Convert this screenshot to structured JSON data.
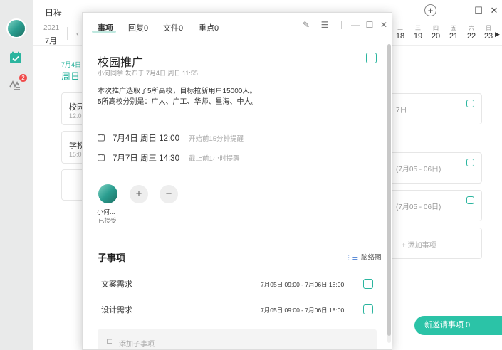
{
  "rail": {
    "badge": "2"
  },
  "app": {
    "title": "日程"
  },
  "datebar": {
    "year": "2021",
    "month": "7月",
    "days": [
      {
        "w": "二",
        "d": "18"
      },
      {
        "w": "三",
        "d": "19"
      },
      {
        "w": "四",
        "d": "20"
      },
      {
        "w": "五",
        "d": "21"
      },
      {
        "w": "六",
        "d": "22"
      },
      {
        "w": "日",
        "d": "23"
      }
    ]
  },
  "selected": {
    "small": "7月4日",
    "big": "周日"
  },
  "bg_cards": [
    {
      "t": "校园",
      "s": "12:0"
    },
    {
      "t": "学校",
      "s": "15:0"
    }
  ],
  "right_cards": [
    {
      "txt": "7日"
    },
    {
      "txt": "(7月05 - 06日)"
    },
    {
      "txt": "(7月05 - 06日)"
    }
  ],
  "add_event": "添加事项",
  "new_invite": "新邀请事项 0",
  "modal": {
    "tabs": [
      "事项",
      "回复0",
      "文件0",
      "重点0"
    ],
    "title": "校园推广",
    "meta": "小何同学 发布于 7月4日 周日 11:55",
    "desc_line1": "本次推广选取了5所高校，目标拉新用户15000人。",
    "desc_line2": "5所高校分别是：广大、广工、华师、星海、中大。",
    "start_time": "7月4日 周日 12:00",
    "start_remind": "开始前15分钟提醒",
    "end_time": "7月7日 周三 14:30",
    "end_remind": "截止前1小时提醒",
    "person_name": "小何...",
    "person_status": "已接受",
    "subtasks_title": "子事项",
    "mindmap": "脑络图",
    "subtasks": [
      {
        "name": "文案需求",
        "date": "7月05日 09:00 - 7月06日 18:00"
      },
      {
        "name": "设计需求",
        "date": "7月05日 09:00 - 7月06日 18:00"
      }
    ],
    "add_subtask": "添加子事项"
  }
}
